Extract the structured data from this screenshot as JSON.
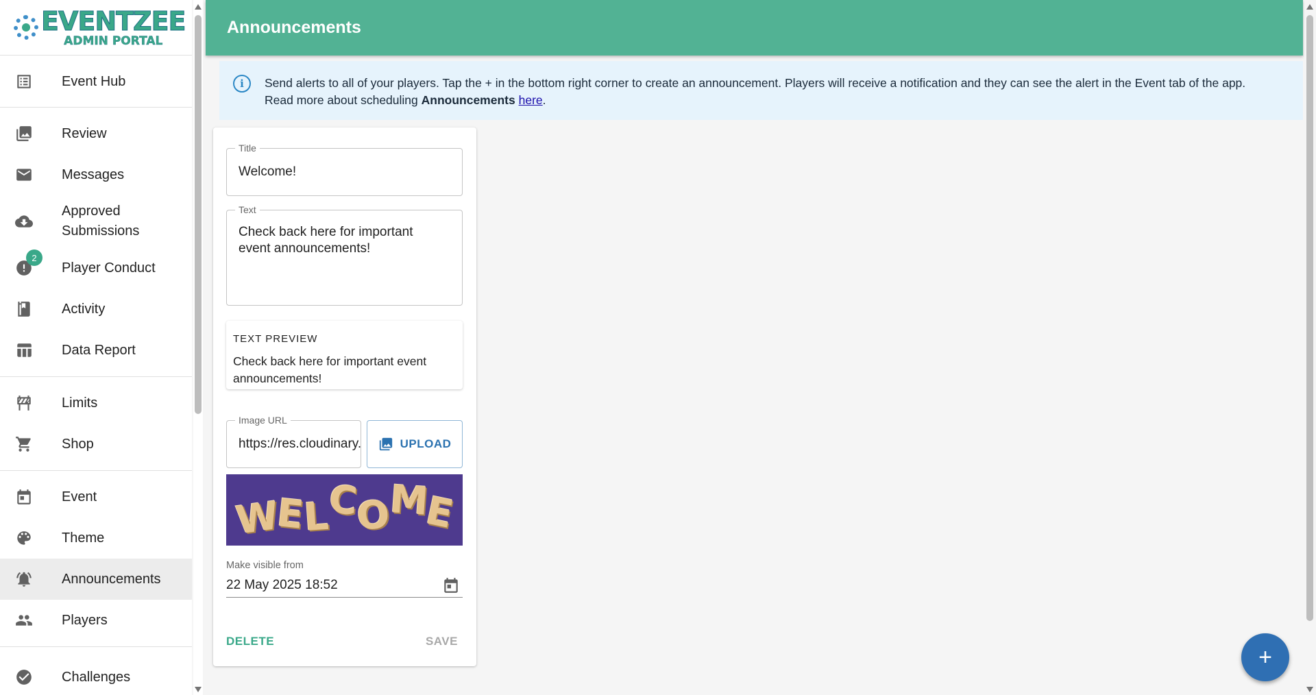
{
  "logo": {
    "title": "EVENTZEE",
    "subtitle": "ADMIN PORTAL"
  },
  "sidebar": {
    "groups": [
      [
        {
          "label": "Event Hub",
          "icon": "list-icon"
        }
      ],
      [
        {
          "label": "Review",
          "icon": "image-icon"
        },
        {
          "label": "Messages",
          "icon": "mail-icon"
        },
        {
          "label": "Approved Submissions",
          "icon": "cloud-download-icon"
        },
        {
          "label": "Player Conduct",
          "icon": "alert-icon",
          "badge": "2"
        },
        {
          "label": "Activity",
          "icon": "notebook-icon"
        },
        {
          "label": "Data Report",
          "icon": "table-icon"
        }
      ],
      [
        {
          "label": "Limits",
          "icon": "barrier-icon"
        },
        {
          "label": "Shop",
          "icon": "cart-icon"
        }
      ],
      [
        {
          "label": "Event",
          "icon": "calendar-icon"
        },
        {
          "label": "Theme",
          "icon": "palette-icon"
        },
        {
          "label": "Announcements",
          "icon": "bell-ring-icon",
          "active": true
        },
        {
          "label": "Players",
          "icon": "people-icon"
        }
      ],
      [
        {
          "label": "Challenges",
          "icon": "check-circle-icon"
        }
      ]
    ]
  },
  "header": {
    "title": "Announcements"
  },
  "info": {
    "line1": "Send alerts to all of your players. Tap the + in the bottom right corner to create an announcement. Players will receive a notification and they can see the alert in the Event tab of the app.",
    "line2_prefix": "Read more about scheduling ",
    "line2_bold": "Announcements",
    "line2_link": "here",
    "line2_suffix": "."
  },
  "form": {
    "title_label": "Title",
    "title_value": "Welcome!",
    "text_label": "Text",
    "text_value": "Check back here for important event announcements!",
    "preview_label": "TEXT PREVIEW",
    "preview_text": "Check back here for important event announcements!",
    "image_url_label": "Image URL",
    "image_url_value": "https://res.cloudinary.com",
    "upload_label": "UPLOAD",
    "image_letters": [
      "W",
      "E",
      "L",
      "C",
      "O",
      "M",
      "E"
    ],
    "visible_from_label": "Make visible from",
    "visible_from_value": "22 May 2025 18:52",
    "delete_label": "DELETE",
    "save_label": "SAVE"
  },
  "fab": {
    "label": "+"
  }
}
